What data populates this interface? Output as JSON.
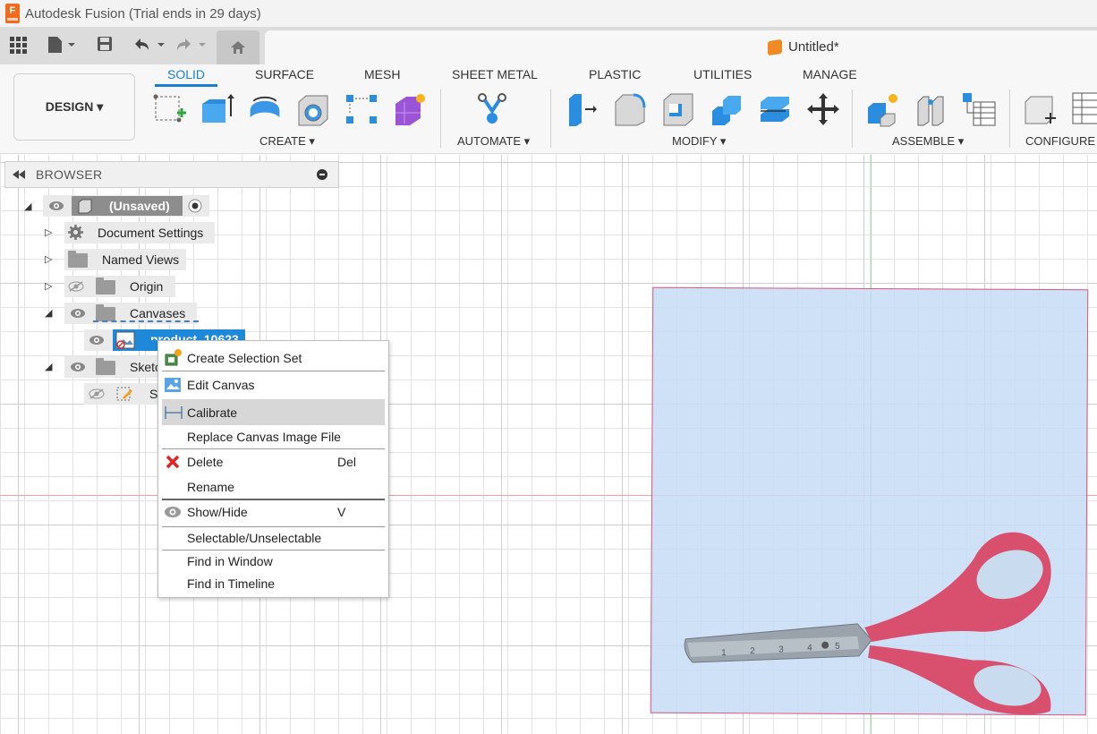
{
  "window": {
    "title": "Autodesk Fusion (Trial ends in 29 days)",
    "logo_letter": "F"
  },
  "document": {
    "tab_title": "Untitled*"
  },
  "ribbon": {
    "workspace_button": "DESIGN ▾",
    "tabs": [
      "SOLID",
      "SURFACE",
      "MESH",
      "SHEET METAL",
      "PLASTIC",
      "UTILITIES",
      "MANAGE"
    ],
    "active_tab": "SOLID",
    "groups": [
      "CREATE ▾",
      "AUTOMATE ▾",
      "MODIFY ▾",
      "ASSEMBLE ▾",
      "CONFIGURE"
    ]
  },
  "browser": {
    "title": "BROWSER",
    "root_label": "(Unsaved)",
    "items": [
      {
        "label": "Document Settings"
      },
      {
        "label": "Named Views"
      },
      {
        "label": "Origin"
      },
      {
        "label": "Canvases"
      },
      {
        "label": "product_10623"
      },
      {
        "label": "Sketc"
      },
      {
        "label": "S"
      }
    ]
  },
  "context_menu": {
    "items": [
      {
        "label": "Create Selection Set",
        "shortcut": ""
      },
      {
        "label": "Edit Canvas",
        "shortcut": ""
      },
      {
        "label": "Calibrate",
        "shortcut": ""
      },
      {
        "label": "Replace Canvas Image File",
        "shortcut": ""
      },
      {
        "label": "Delete",
        "shortcut": "Del"
      },
      {
        "label": "Rename",
        "shortcut": ""
      },
      {
        "label": "Show/Hide",
        "shortcut": "V"
      },
      {
        "label": "Selectable/Unselectable",
        "shortcut": ""
      },
      {
        "label": "Find in Window",
        "shortcut": ""
      },
      {
        "label": "Find in Timeline",
        "shortcut": ""
      }
    ],
    "highlighted": "Calibrate"
  },
  "canvas_image": {
    "ruler_ticks": [
      "1",
      "2",
      "3",
      "4",
      "5"
    ],
    "colors": {
      "handle": "#d8506e",
      "frame": "#e0577a",
      "tint": "#c6dcf6"
    }
  },
  "colors": {
    "accent": "#1a80d2",
    "selection": "#1e88d9"
  }
}
